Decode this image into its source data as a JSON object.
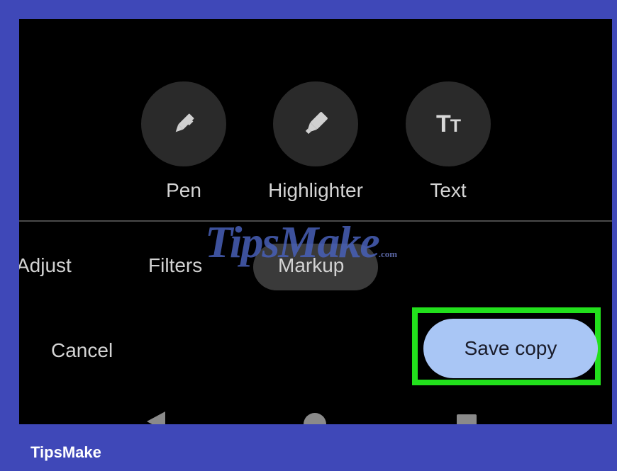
{
  "tools": [
    {
      "label": "Pen",
      "icon": "pen-icon"
    },
    {
      "label": "Highlighter",
      "icon": "highlighter-icon"
    },
    {
      "label": "Text",
      "icon": "text-icon",
      "glyph_big": "T",
      "glyph_small": "T"
    }
  ],
  "tabs": [
    {
      "label": "Adjust"
    },
    {
      "label": "Filters"
    },
    {
      "label": "Markup",
      "active": true
    }
  ],
  "actions": {
    "cancel_label": "Cancel",
    "save_label": "Save copy"
  },
  "nav_bar": {
    "back_icon": "back-triangle-icon",
    "home_icon": "home-circle-icon",
    "recents_icon": "recents-square-icon"
  },
  "watermark": {
    "main": "TipsMake",
    "suffix": ".com"
  },
  "brand_caption": "TipsMake",
  "colors": {
    "frame": "#3f48b8",
    "screen": "#000000",
    "save_button": "#a9c6f5",
    "highlight": "#22e01c"
  }
}
